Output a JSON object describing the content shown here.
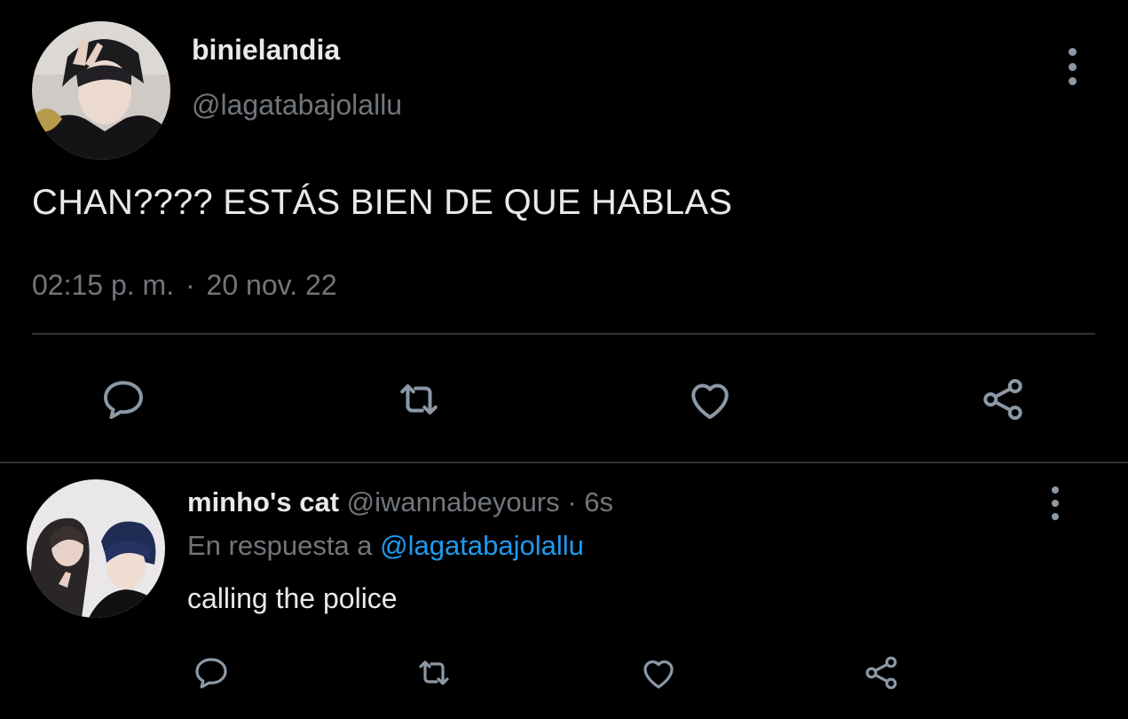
{
  "main_tweet": {
    "display_name": "binielandia",
    "handle": "@lagatabajolallu",
    "text": "CHAN???? ESTÁS BIEN DE QUE HABLAS",
    "time": "02:15 p. m.",
    "separator": "·",
    "date": "20 nov. 22",
    "actions": [
      "reply-icon",
      "retweet-icon",
      "like-icon",
      "share-icon"
    ]
  },
  "reply_tweet": {
    "display_name": "minho's cat",
    "handle": "@iwannabeyours",
    "separator": "·",
    "time": "6s",
    "reply_prefix": "En respuesta a",
    "reply_to_handle": "@lagatabajolallu",
    "text": "calling the police",
    "actions": [
      "reply-icon",
      "retweet-icon",
      "like-icon",
      "share-icon"
    ]
  },
  "colors": {
    "background": "#000000",
    "text_primary": "#e7e9ea",
    "text_secondary": "#71767b",
    "icon": "#8b98a5",
    "link": "#1d9bf0",
    "divider": "#2f3336"
  }
}
